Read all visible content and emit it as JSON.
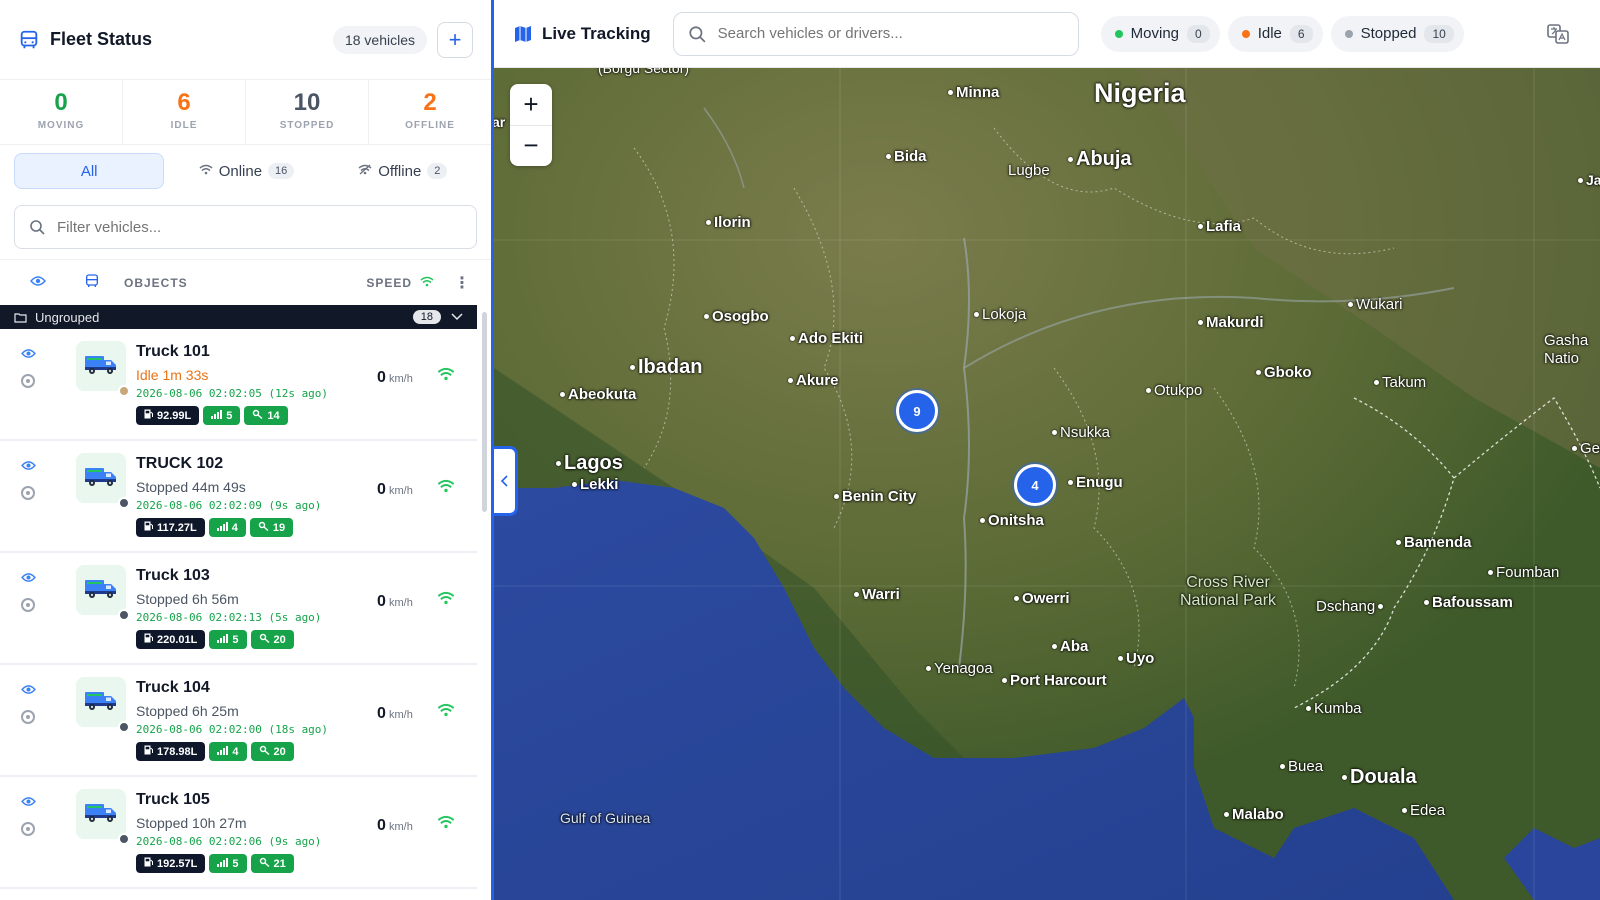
{
  "sidebar": {
    "title": "Fleet Status",
    "vehicle_count": "18 vehicles",
    "add_label": "+",
    "stats": [
      {
        "value": "0",
        "label": "MOVING",
        "color": "#16a34a"
      },
      {
        "value": "6",
        "label": "IDLE",
        "color": "#f97316"
      },
      {
        "value": "10",
        "label": "STOPPED",
        "color": "#4b5563"
      },
      {
        "value": "2",
        "label": "OFFLINE",
        "color": "#f97316"
      }
    ],
    "tabs": {
      "all": "All",
      "online": "Online",
      "online_count": "16",
      "offline": "Offline",
      "offline_count": "2"
    },
    "filter_placeholder": "Filter vehicles...",
    "columns": {
      "objects": "OBJECTS",
      "speed": "SPEED"
    },
    "group": {
      "name": "Ungrouped",
      "count": "18"
    },
    "vehicles": [
      {
        "name": "Truck 101",
        "status": "Idle 1m 33s",
        "status_color": "#ea7317",
        "dot_color": "#c9a77a",
        "time": "2026-08-06 02:02:05 (12s ago)",
        "speed": "0",
        "unit": "km/h",
        "fuel": "92.99L",
        "signal": "5",
        "sats": "14"
      },
      {
        "name": "TRUCK 102",
        "status": "Stopped 44m 49s",
        "status_color": "#4b5563",
        "dot_color": "#4b5563",
        "time": "2026-08-06 02:02:09 (9s ago)",
        "speed": "0",
        "unit": "km/h",
        "fuel": "117.27L",
        "signal": "4",
        "sats": "19"
      },
      {
        "name": "Truck 103",
        "status": "Stopped 6h 56m",
        "status_color": "#4b5563",
        "dot_color": "#4b5563",
        "time": "2026-08-06 02:02:13 (5s ago)",
        "speed": "0",
        "unit": "km/h",
        "fuel": "220.01L",
        "signal": "5",
        "sats": "20"
      },
      {
        "name": "Truck 104",
        "status": "Stopped 6h 25m",
        "status_color": "#4b5563",
        "dot_color": "#4b5563",
        "time": "2026-08-06 02:02:00 (18s ago)",
        "speed": "0",
        "unit": "km/h",
        "fuel": "178.98L",
        "signal": "4",
        "sats": "20"
      },
      {
        "name": "Truck 105",
        "status": "Stopped 10h 27m",
        "status_color": "#4b5563",
        "dot_color": "#4b5563",
        "time": "2026-08-06 02:02:06 (9s ago)",
        "speed": "0",
        "unit": "km/h",
        "fuel": "192.57L",
        "signal": "5",
        "sats": "21"
      }
    ]
  },
  "topbar": {
    "title": "Live Tracking",
    "search_placeholder": "Search vehicles or drivers...",
    "pills": [
      {
        "label": "Moving",
        "count": "0",
        "color": "#22c55e"
      },
      {
        "label": "Idle",
        "count": "6",
        "color": "#f97316"
      },
      {
        "label": "Stopped",
        "count": "10",
        "color": "#9ca3af"
      }
    ]
  },
  "map": {
    "zoom_in": "+",
    "zoom_out": "−",
    "clusters": [
      {
        "count": "9"
      },
      {
        "count": "4"
      }
    ],
    "places": {
      "nigeria": "Nigeria",
      "borgu": "(Borgu Sector)",
      "minna": "Minna",
      "bida": "Bida",
      "lugbe": "Lugbe",
      "abuja": "Abuja",
      "ilorin": "Ilorin",
      "lafia": "Lafia",
      "ja": "Ja",
      "osogbo": "Osogbo",
      "ado_ekiti": "Ado Ekiti",
      "lokoja": "Lokoja",
      "wukari": "Wukari",
      "makurdi": "Makurdi",
      "gashaka": "Gasha Natio",
      "ibadan": "Ibadan",
      "akure": "Akure",
      "otukpo": "Otukpo",
      "gboko": "Gboko",
      "takum": "Takum",
      "abeokuta": "Abeokuta",
      "nsukka": "Nsukka",
      "gem": "Gem",
      "lagos": "Lagos",
      "lekki": "Lekki",
      "enugu": "Enugu",
      "benin_city": "Benin City",
      "onitsha": "Onitsha",
      "bamenda": "Bamenda",
      "foumban": "Foumban",
      "cross_river": "Cross River National Park",
      "warri": "Warri",
      "owerri": "Owerri",
      "dschang": "Dschang",
      "bafoussam": "Bafoussam",
      "aba": "Aba",
      "uyo": "Uyo",
      "yenagoa": "Yenagoa",
      "port_harcourt": "Port Harcourt",
      "kumba": "Kumba",
      "buea": "Buea",
      "douala": "Douala",
      "edea": "Edea",
      "gulf_of_guinea": "Gulf of Guinea",
      "malabo": "Malabo",
      "ar": "ar"
    }
  }
}
